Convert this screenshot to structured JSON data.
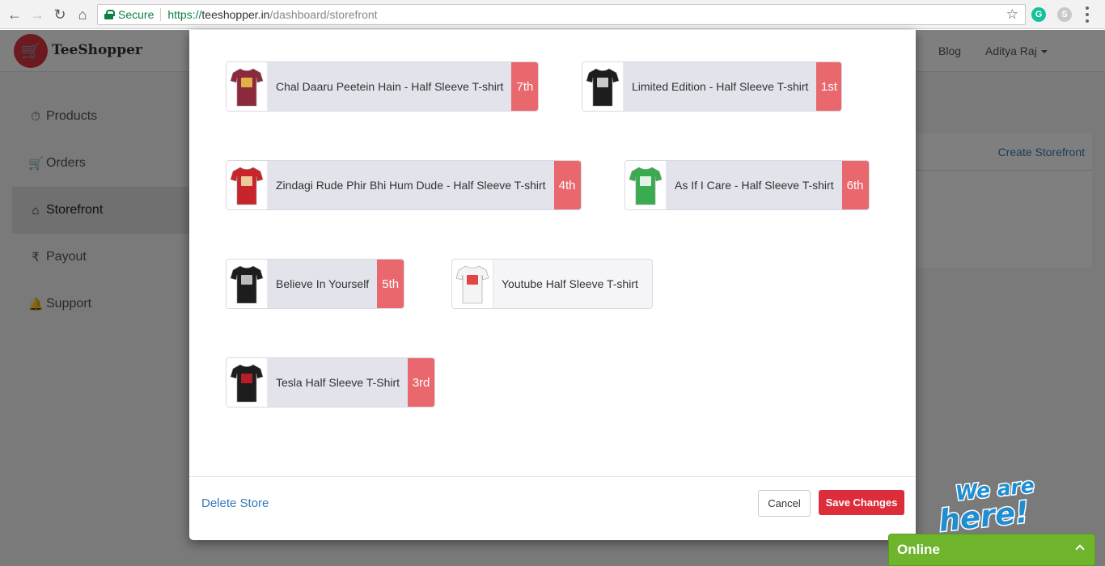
{
  "browser": {
    "secure_label": "Secure",
    "url_scheme": "https://",
    "url_host": "teeshopper.in",
    "url_path": "/dashboard/storefront"
  },
  "site": {
    "brand": "TeeShopper",
    "top_links": [
      "Blog",
      "Aditya Raj"
    ],
    "sidebar": [
      {
        "label": "Products",
        "icon": "dashboard-icon"
      },
      {
        "label": "Orders",
        "icon": "cart-icon"
      },
      {
        "label": "Storefront",
        "icon": "home-icon"
      },
      {
        "label": "Payout",
        "icon": "rupee-icon"
      },
      {
        "label": "Support",
        "icon": "bell-icon"
      }
    ],
    "create_storefront": "Create Storefront"
  },
  "modal": {
    "products": [
      {
        "name": "Chal Daaru Peetein Hain - Half Sleeve T-shirt",
        "rank": "7th",
        "tee_color": "#8c2a3c",
        "print": "#f0c84a"
      },
      {
        "name": "Limited Edition - Half Sleeve T-shirt",
        "rank": "1st",
        "tee_color": "#1d1d1d",
        "print": "#e8e8e8"
      },
      {
        "name": "Zindagi Rude Phir Bhi Hum Dude - Half Sleeve T-shirt",
        "rank": "4th",
        "tee_color": "#c8242c",
        "print": "#f2e6b0"
      },
      {
        "name": "As If I Care - Half Sleeve T-shirt",
        "rank": "6th",
        "tee_color": "#3aab4f",
        "print": "#ffffff"
      },
      {
        "name": "Believe In Yourself",
        "rank": "5th",
        "tee_color": "#1d1d1d",
        "print": "#d8d8d8"
      },
      {
        "name": "Youtube Half Sleeve T-shirt",
        "rank": "",
        "tee_color": "#f4f4f4",
        "print": "#e02424"
      },
      {
        "name": "Tesla Half Sleeve T-Shirt",
        "rank": "3rd",
        "tee_color": "#1d1d1d",
        "print": "#d01f2a"
      }
    ],
    "delete_label": "Delete Store",
    "cancel_label": "Cancel",
    "save_label": "Save Changes"
  },
  "chat": {
    "badge_line1": "We are",
    "badge_line2": "here!",
    "status": "Online"
  }
}
